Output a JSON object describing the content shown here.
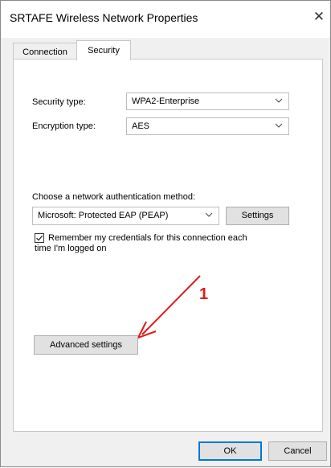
{
  "window": {
    "title": "SRTAFE Wireless Network Properties",
    "close_glyph": "✕"
  },
  "tabs": [
    {
      "label": "Connection",
      "active": false
    },
    {
      "label": "Security",
      "active": true
    }
  ],
  "security": {
    "security_type_label": "Security type:",
    "security_type_value": "WPA2-Enterprise",
    "encryption_type_label": "Encryption type:",
    "encryption_type_value": "AES",
    "auth_method_label": "Choose a network authentication method:",
    "auth_method_value": "Microsoft: Protected EAP (PEAP)",
    "settings_button": "Settings",
    "remember_label_line1": "Remember my credentials for this connection each",
    "remember_label_line2": "time I'm logged on",
    "remember_checked": true,
    "advanced_button": "Advanced settings"
  },
  "footer": {
    "ok_button": "OK",
    "cancel_button": "Cancel"
  },
  "annotation": {
    "number": "1",
    "color": "#e01b1b"
  },
  "icons": {
    "dropdown": "chevron-down-icon",
    "close": "close-icon",
    "check": "check-icon"
  }
}
